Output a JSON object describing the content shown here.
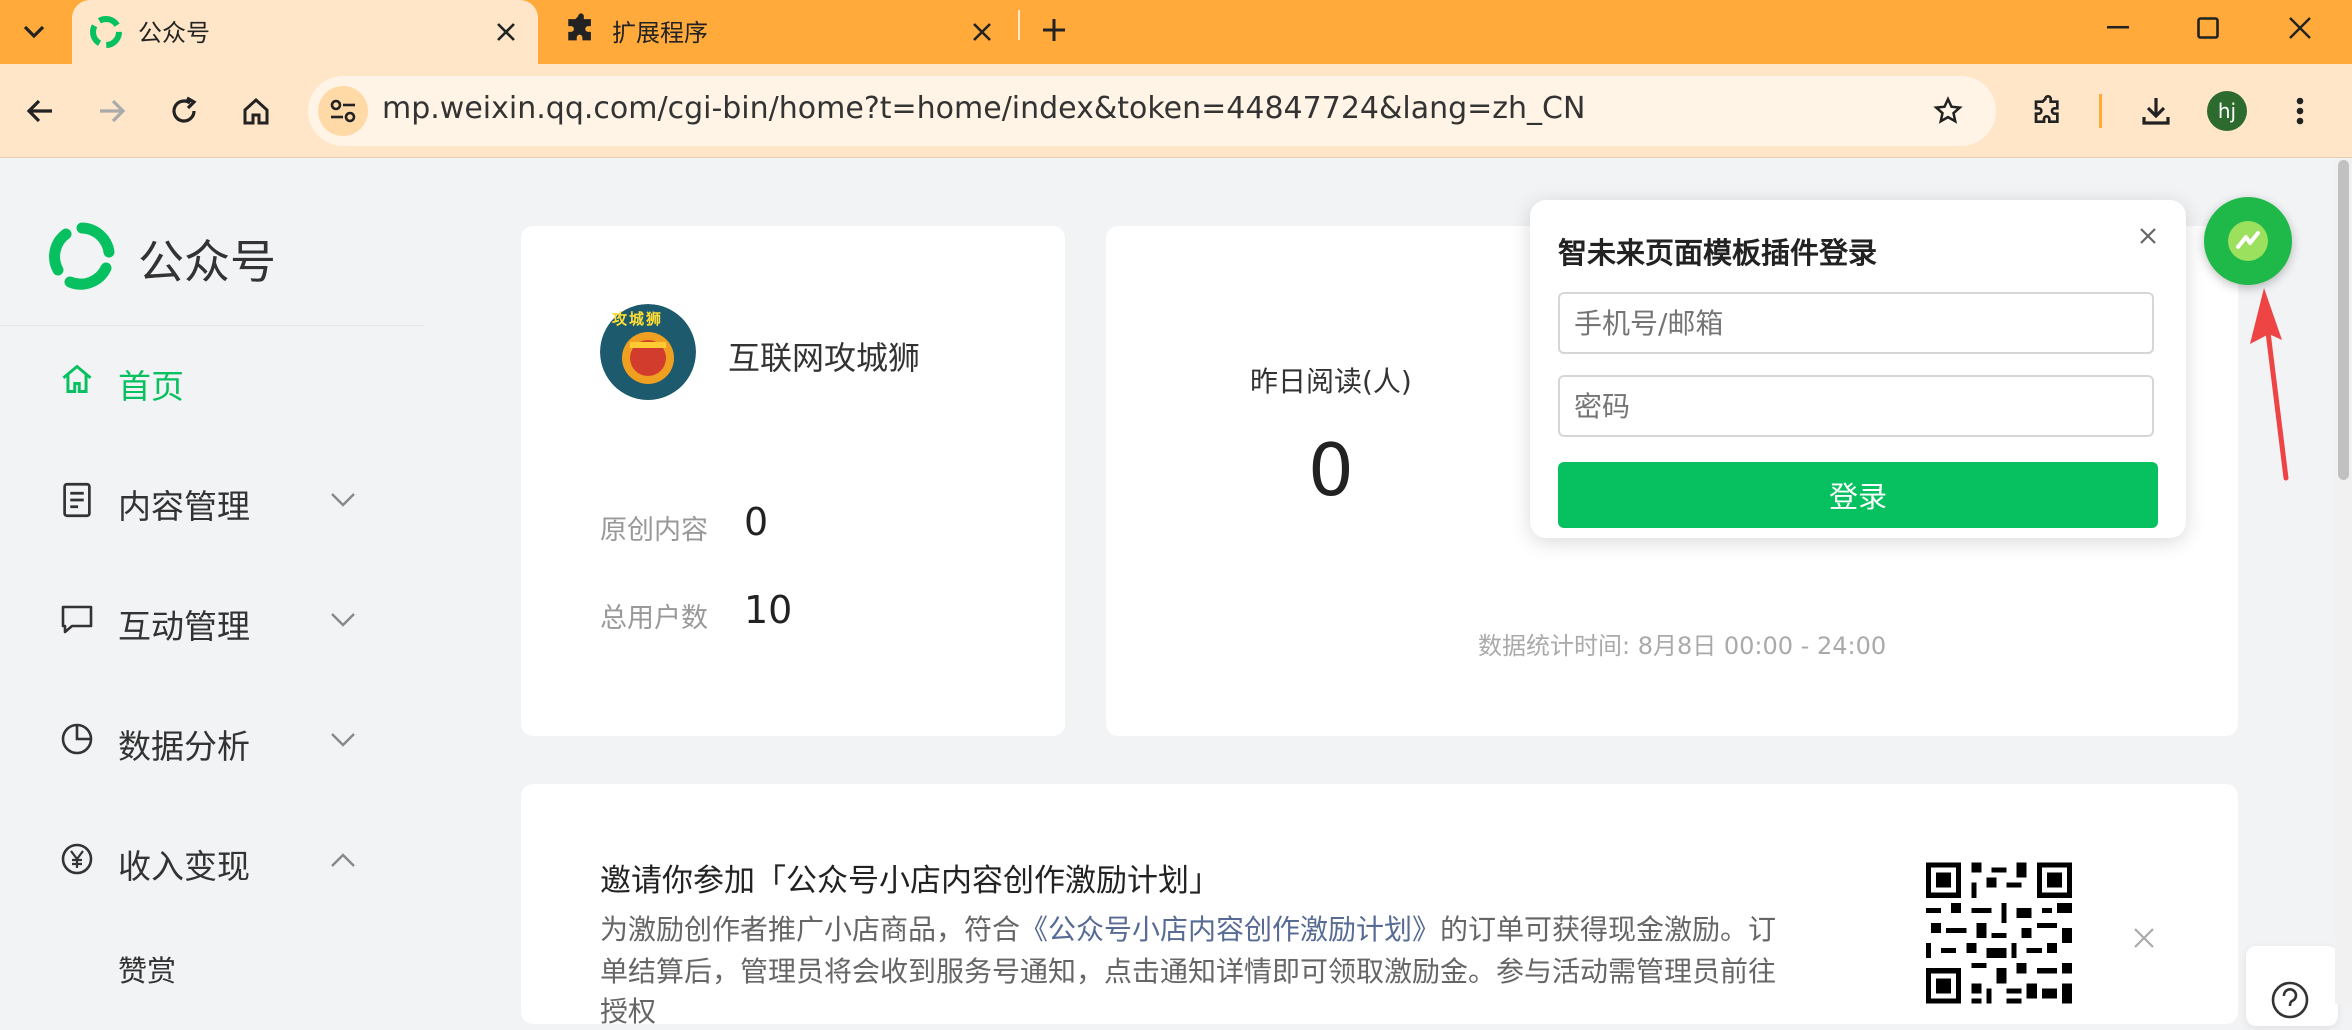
{
  "browser": {
    "tabs": [
      {
        "label": "公众号",
        "active": true
      },
      {
        "label": "扩展程序",
        "active": false
      }
    ],
    "url": "mp.weixin.qq.com/cgi-bin/home?t=home/index&token=44847724&lang=zh_CN",
    "profile_initials": "hj",
    "accent": "#ffaa3b"
  },
  "sidebar": {
    "logo_text": "公众号",
    "items": [
      {
        "label": "首页",
        "icon": "home-icon",
        "active": true
      },
      {
        "label": "内容管理",
        "icon": "document-icon",
        "expand": "down"
      },
      {
        "label": "互动管理",
        "icon": "chat-icon",
        "expand": "down"
      },
      {
        "label": "数据分析",
        "icon": "pie-chart-icon",
        "expand": "down"
      },
      {
        "label": "收入变现",
        "icon": "yen-icon",
        "expand": "up"
      },
      {
        "label": "赞赏",
        "sub": true
      }
    ]
  },
  "account": {
    "name": "互联网攻城狮",
    "avatar_text": "攻城狮",
    "original_label": "原创内容",
    "original_value": "0",
    "users_label": "总用户数",
    "users_value": "10"
  },
  "stats": {
    "yesterday_reads_label": "昨日阅读(人)",
    "yesterday_reads_value": "0",
    "stat_time": "数据统计时间: 8月8日 00:00 - 24:00"
  },
  "popup": {
    "title": "智未来页面模板插件登录",
    "phone_placeholder": "手机号/邮箱",
    "password_placeholder": "密码",
    "login_label": "登录"
  },
  "invite": {
    "title": "邀请你参加「公众号小店内容创作激励计划」",
    "line1_prefix": "为激励创作者推广小店商品，符合",
    "line1_link": "《公众号小店内容创作激励计划》",
    "line1_suffix": "的订单可获得现金激励。订",
    "line2": "单结算后，管理员将会收到服务号通知，点击通知详情即可领取激励金。参与活动需管理员前往",
    "line3": "授权"
  },
  "colors": {
    "brand_green": "#07c160",
    "link_blue": "#576b95"
  }
}
